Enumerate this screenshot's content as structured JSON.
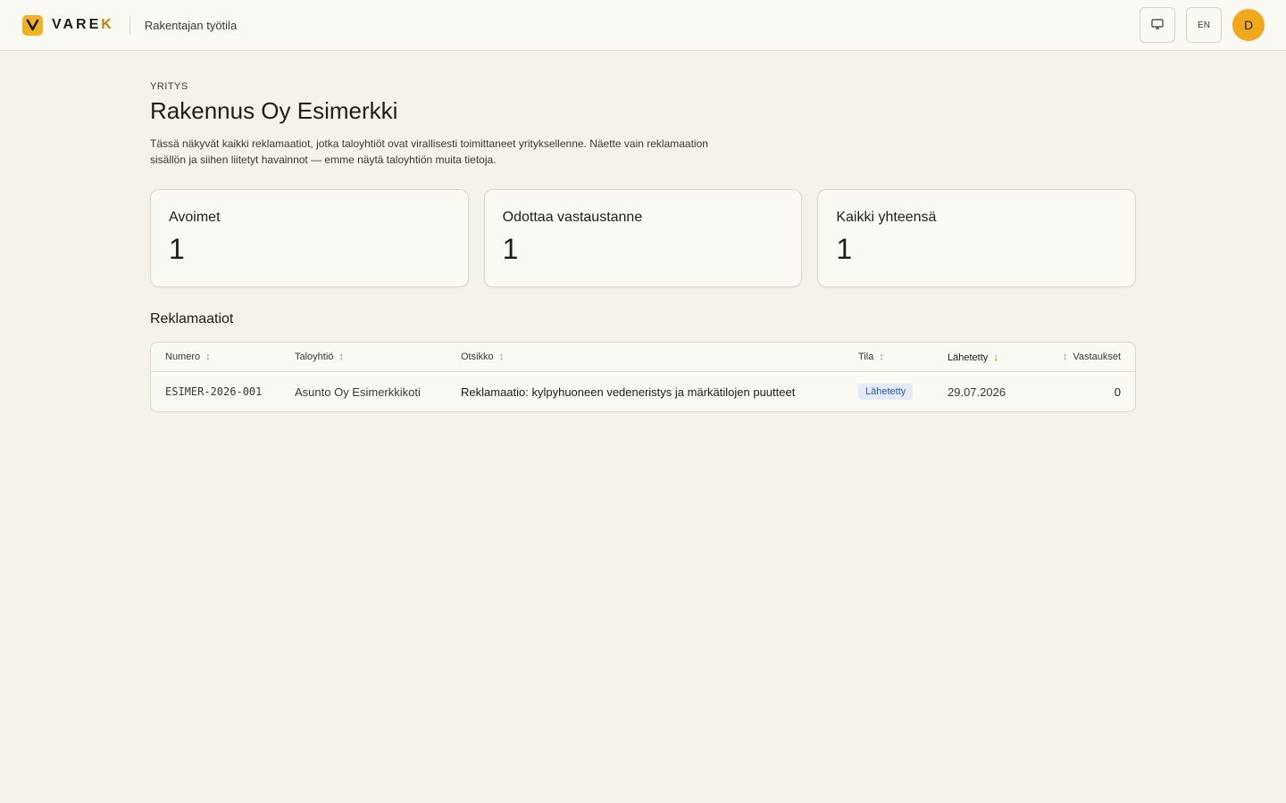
{
  "header": {
    "brand_main": "VARE",
    "brand_accent": "K",
    "workspace": "Rakentajan työtila",
    "display_icon": "monitor-icon",
    "language": "EN",
    "avatar_initial": "D"
  },
  "page": {
    "eyebrow": "YRITYS",
    "title": "Rakennus Oy Esimerkki",
    "intro": "Tässä näkyvät kaikki reklamaatiot, jotka taloyhtiöt ovat virallisesti toimittaneet yrityksellenne. Näette vain reklamaation sisällön ja siihen liitetyt havainnot — emme näytä taloyhtiön muita tietoja."
  },
  "stats": [
    {
      "label": "Avoimet",
      "value": "1"
    },
    {
      "label": "Odottaa vastaustanne",
      "value": "1"
    },
    {
      "label": "Kaikki yhteensä",
      "value": "1"
    }
  ],
  "table": {
    "title": "Reklamaatiot",
    "columns": {
      "numero": "Numero",
      "taloyhtio": "Taloyhtiö",
      "otsikko": "Otsikko",
      "tila": "Tila",
      "lahetetty": "Lähetetty",
      "vastaukset": "Vastaukset"
    },
    "sort_column": "Lähetetty",
    "sort_direction": "descending",
    "rows": [
      {
        "numero": "ESIMER-2026-001",
        "taloyhtio": "Asunto Oy Esimerkkikoti",
        "otsikko": "Reklamaatio: kylpyhuoneen vedeneristys ja märkätilojen puutteet",
        "tila": "Lähetetty",
        "lahetetty": "29.07.2026",
        "vastaukset": "0"
      }
    ]
  },
  "colors": {
    "accent": "#f0b323",
    "badge_bg": "#e3ebf8",
    "badge_text": "#2c5aa0"
  }
}
